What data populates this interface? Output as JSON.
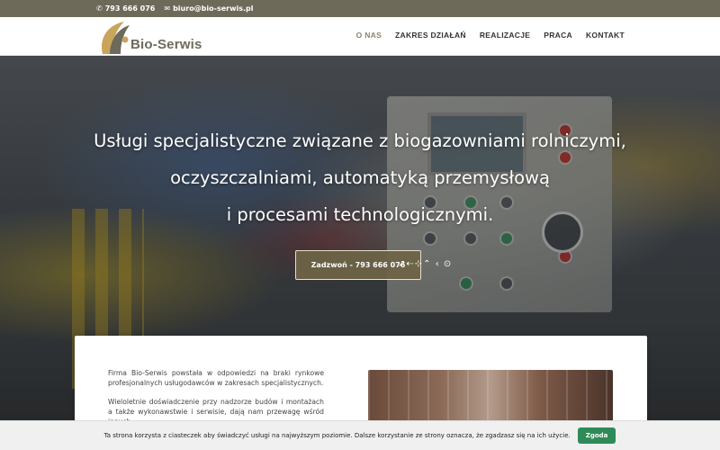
{
  "topbar": {
    "phone": "793 666 076",
    "email": "biuro@bio-serwis.pl",
    "phone_icon": "phone-icon",
    "email_icon": "envelope-icon"
  },
  "header": {
    "logo_text": "Bio-Serwis",
    "nav": [
      {
        "label": "O NAS",
        "active": true
      },
      {
        "label": "ZAKRES DZIAŁAŃ",
        "active": false
      },
      {
        "label": "REALIZACJE",
        "active": false
      },
      {
        "label": "PRACA",
        "active": false
      },
      {
        "label": "KONTAKT",
        "active": false
      }
    ]
  },
  "hero": {
    "line1": "Usługi specjalistyczne związane z biogazowniami rolniczymi,",
    "line2": "oczyszczalniami, automatyką przemysłową",
    "line3": "i procesami technologicznymi.",
    "button_label": "Zadzwoń - 793 666 076",
    "button_arrow": "↗",
    "extra_icons": "⇠⊹⌃ ‹ ⊙"
  },
  "content": {
    "para1": "Firma Bio-Serwis powstała w odpowiedzi na braki rynkowe profesjonalnych usługodawców w zakresach specjalistycznych.",
    "para2": "Wieloletnie doświadczenie przy nadzorze budów i montażach a także wykonawstwie i serwisie, dają nam przewagę wśród innych"
  },
  "cookie": {
    "text": "Ta strona korzysta z ciasteczek aby świadczyć usługi na najwyższym poziomie. Dalsze korzystanie ze strony oznacza, że zgadzasz się na ich użycie.",
    "button": "Zgoda"
  },
  "colors": {
    "topbar_bg": "#6e6a5a",
    "accent_gold": "#8a8668",
    "cookie_btn": "#2e8b57"
  }
}
